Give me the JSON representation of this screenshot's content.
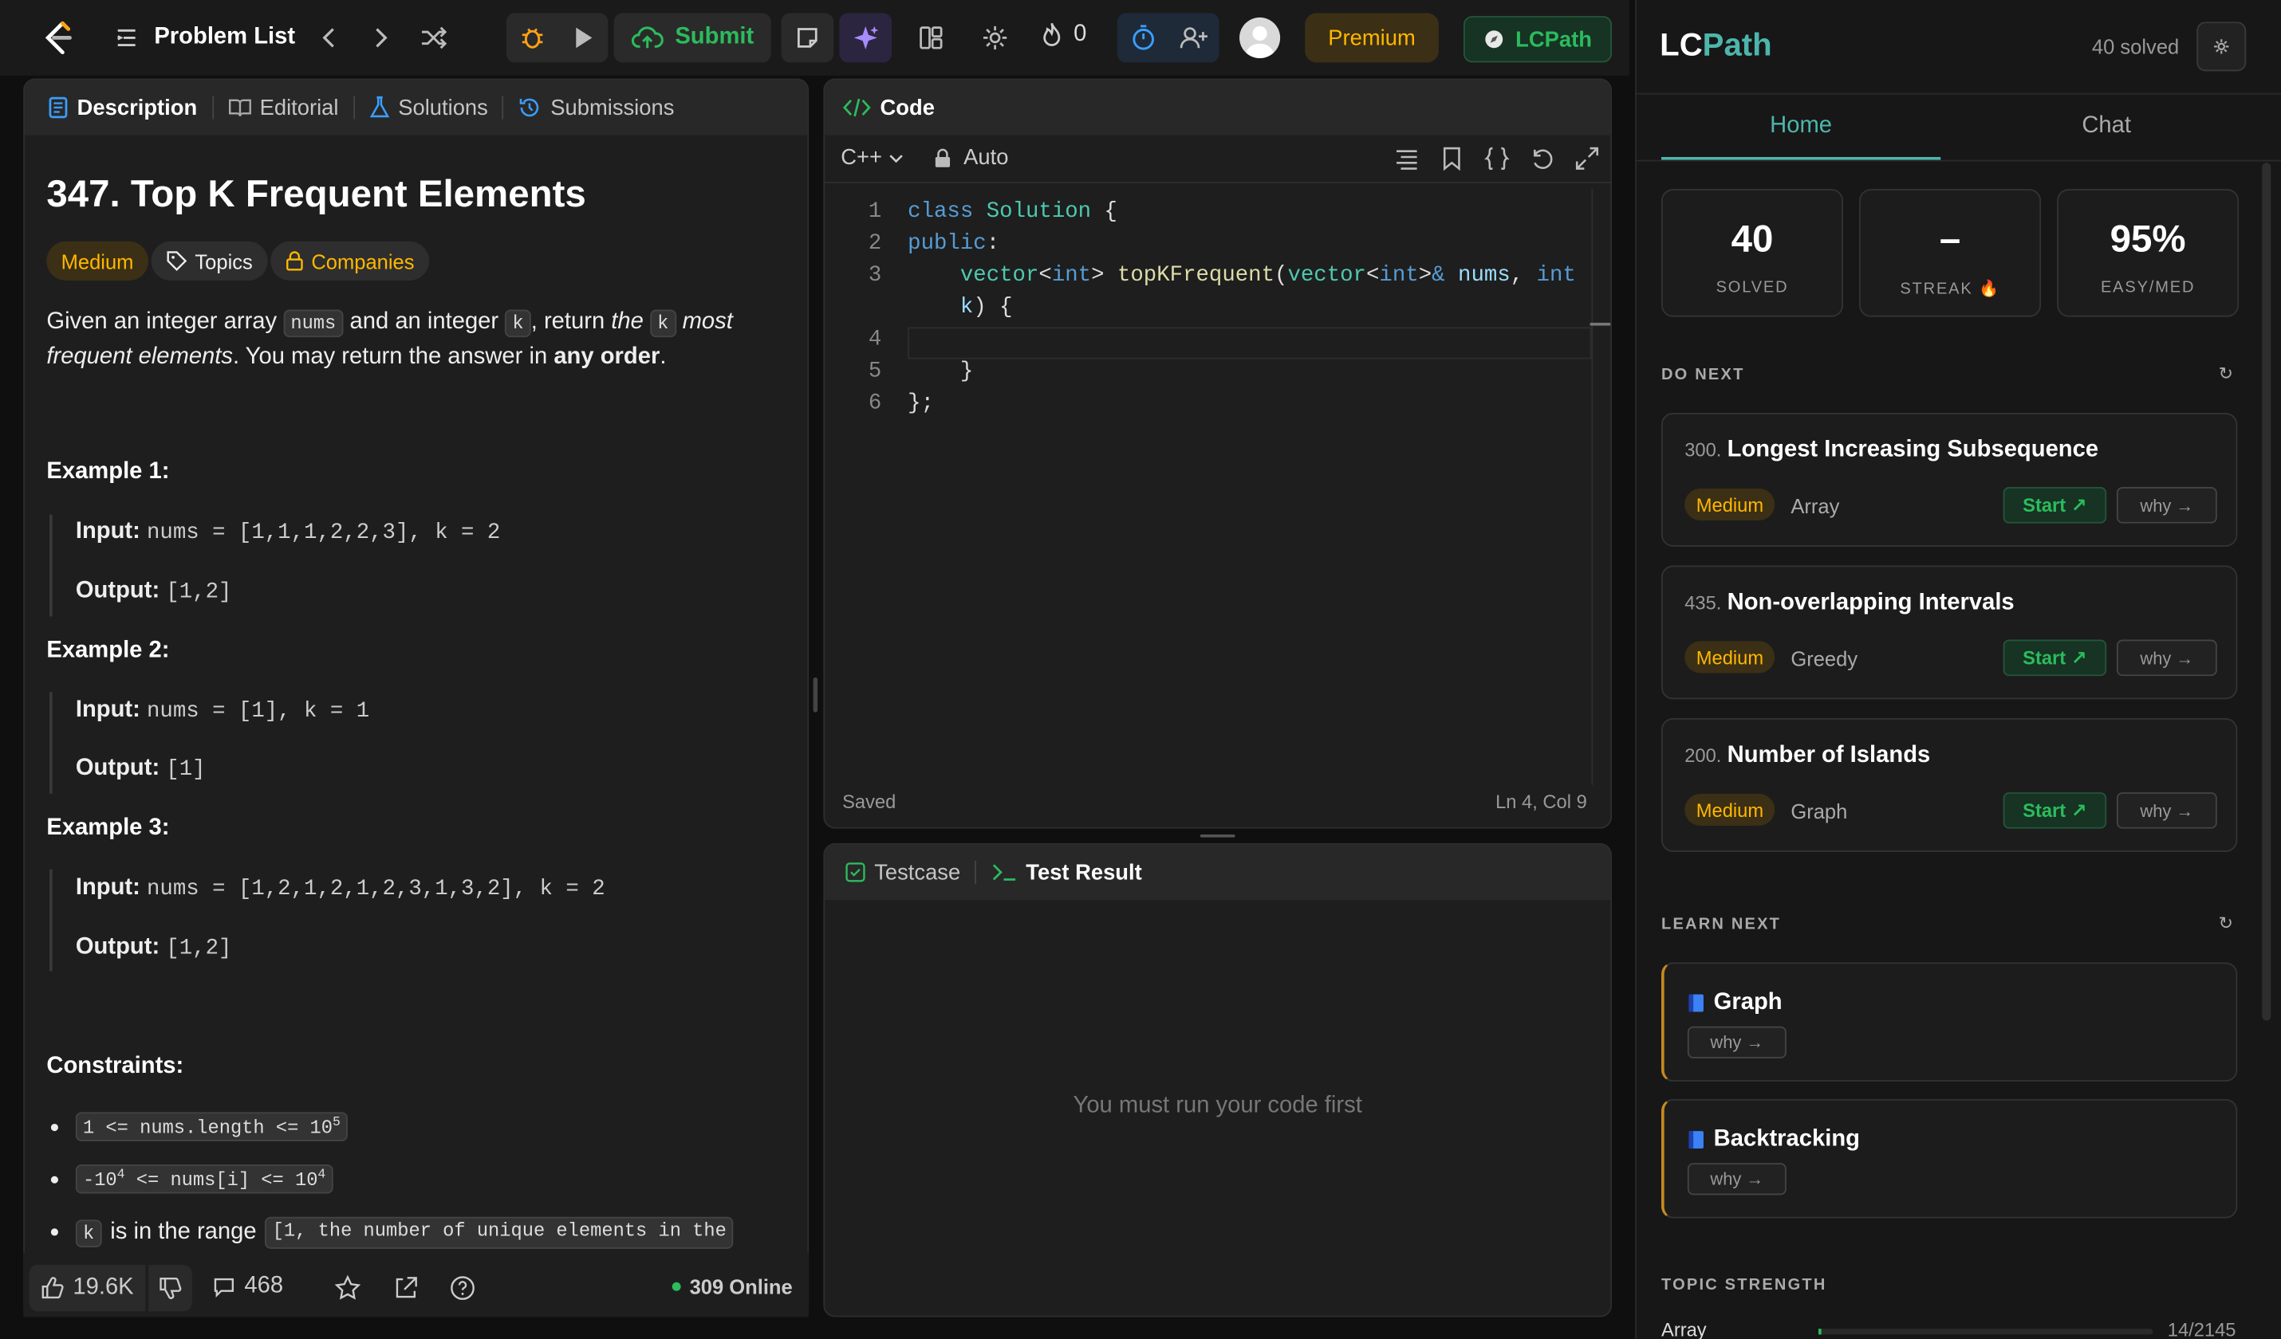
{
  "nav": {
    "problem_list": "Problem List",
    "submit": "Submit",
    "streak_count": "0",
    "premium": "Premium",
    "ext": "LCPath"
  },
  "left": {
    "tabs": [
      "Description",
      "Editorial",
      "Solutions",
      "Submissions"
    ],
    "title": "347. Top K Frequent Elements",
    "difficulty": "Medium",
    "topics": "Topics",
    "companies": "Companies",
    "desc": {
      "p1": "Given an integer array ",
      "c1": "nums",
      "p2": " and an integer ",
      "c2": "k",
      "p3": ", return ",
      "i1": "the ",
      "c3": "k",
      "i2": " most frequent elements",
      "p4": ". You may return the answer in ",
      "b1": "any order",
      "p5": "."
    },
    "examples": [
      {
        "h": "Example 1:",
        "input": "nums = [1,1,1,2,2,3], k = 2",
        "output": "[1,2]"
      },
      {
        "h": "Example 2:",
        "input": "nums = [1], k = 1",
        "output": "[1]"
      },
      {
        "h": "Example 3:",
        "input": "nums = [1,2,1,2,1,2,3,1,3,2], k = 2",
        "output": "[1,2]"
      }
    ],
    "input_label": "Input:",
    "output_label": "Output:",
    "constraints_h": "Constraints:",
    "cons1": "1 <= nums.length <= 10",
    "cons1_sup": "5",
    "cons2a": "-10",
    "cons2a_sup": "4",
    "cons2b": " <= nums[i] <= 10",
    "cons2b_sup": "4",
    "cons3_k": "k",
    "cons3_text": "is in the range",
    "cons3_code": "[1, the number of unique elements in the",
    "likes": "19.6K",
    "comments": "468",
    "online": "309 Online"
  },
  "code": {
    "tab": "Code",
    "lang": "C++",
    "mode": "Auto",
    "line_numbers": [
      "1",
      "2",
      "3",
      "4",
      "5",
      "6"
    ],
    "saved": "Saved",
    "cursor": "Ln 4, Col 9"
  },
  "test": {
    "tab1": "Testcase",
    "tab2": "Test Result",
    "empty": "You must run your code first"
  },
  "right": {
    "brand_a": "LC",
    "brand_b": "Path",
    "solved_label": "40 solved",
    "tab_home": "Home",
    "tab_chat": "Chat",
    "stats": [
      {
        "v": "40",
        "l": "SOLVED"
      },
      {
        "v": "–",
        "l": "STREAK 🔥"
      },
      {
        "v": "95%",
        "l": "EASY/MED"
      }
    ],
    "do_next": "DO NEXT",
    "cards": [
      {
        "n": "300.",
        "t": "Longest Increasing Subsequence",
        "d": "Medium",
        "topic": "Array"
      },
      {
        "n": "435.",
        "t": "Non-overlapping Intervals",
        "d": "Medium",
        "topic": "Greedy"
      },
      {
        "n": "200.",
        "t": "Number of Islands",
        "d": "Medium",
        "topic": "Graph"
      }
    ],
    "start": "Start ↗",
    "why": "why →",
    "learn_next": "LEARN NEXT",
    "learn": [
      "Graph",
      "Backtracking"
    ],
    "topic_strength": "TOPIC STRENGTH",
    "ts_label": "Array",
    "ts_value": "14/2145"
  },
  "colors": {
    "accent": "#2cbb5d",
    "medium": "#ffb700",
    "teal": "#4db6ac"
  }
}
